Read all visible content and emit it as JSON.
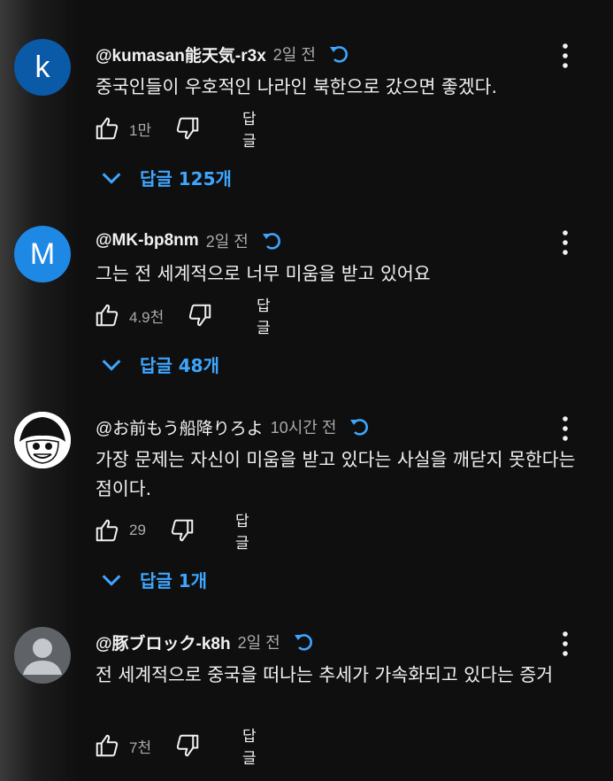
{
  "comments": [
    {
      "author": "@kumasan能天気-r3x",
      "time": "2일 전",
      "avatar_letter": "k",
      "avatar_color": "#0b5aa8",
      "text": "중국인들이 우호적인 나라인 북한으로 갔으면 좋겠다.",
      "likes": "1만",
      "reply_label": "답글",
      "replies_label": "답글 125개"
    },
    {
      "author": "@MK-bp8nm",
      "time": "2일 전",
      "avatar_letter": "M",
      "avatar_color": "#1e88e5",
      "text": "그는 전 세계적으로 너무 미움을 받고 있어요",
      "likes": "4.9천",
      "reply_label": "답글",
      "replies_label": "답글 48개"
    },
    {
      "author": "@お前もう船降りろよ",
      "time": "10시간 전",
      "avatar_letter": "",
      "avatar_color": "#ffffff",
      "text": "가장 문제는 자신이 미움을 받고 있다는 사실을 깨닫지 못한다는 점이다.",
      "likes": "29",
      "reply_label": "답글",
      "replies_label": "답글 1개"
    },
    {
      "author": "@豚ブロック-k8h",
      "time": "2일 전",
      "avatar_letter": "",
      "avatar_color": "#5f6368",
      "text": "전 세계적으로 중국을 떠나는 추세가 가속화되고 있다는 증거",
      "likes": "7천",
      "reply_label": "답글"
    }
  ],
  "colors": {
    "accent": "#3ea6ff",
    "secondary_text": "#aaaaaa"
  },
  "icons": [
    "thumb-up-icon",
    "thumb-down-icon",
    "edited-icon",
    "more-vert-icon",
    "chevron-down-icon"
  ]
}
